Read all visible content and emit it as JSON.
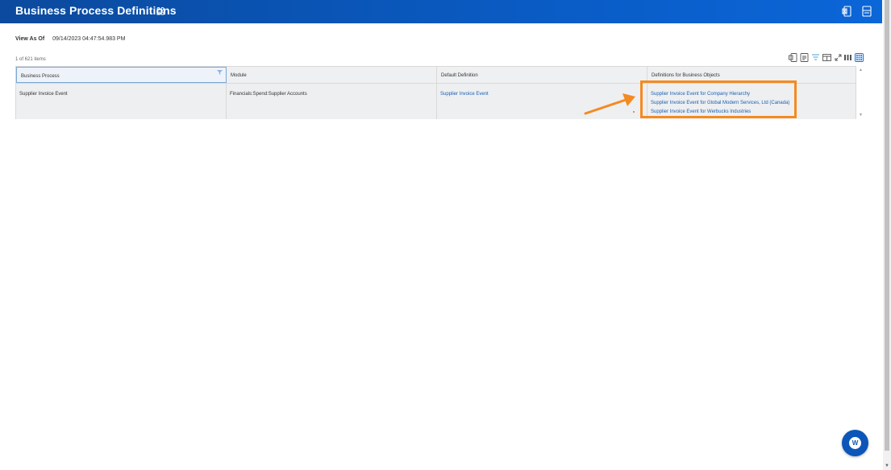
{
  "header": {
    "title": "Business Process Definitions",
    "related_icon": "related-actions-icon",
    "excel_icon": "export-excel-icon",
    "pdf_icon": "export-pdf-icon"
  },
  "view_as_of": {
    "label": "View As Of",
    "value": "09/14/2023 04:47:54.983 PM"
  },
  "items_count": "1 of 621 items",
  "toolbar_icons": [
    "export-excel-icon",
    "export-pdf-icon",
    "filter-icon",
    "view-column-icon",
    "fullscreen-icon",
    "list-view-icon",
    "grid-view-icon"
  ],
  "table": {
    "columns": [
      "Business Process",
      "Module",
      "Default Definition",
      "Definitions for Business Objects"
    ],
    "rows": [
      {
        "business_process": "Supplier Invoice Event",
        "module": "Financials:Spend:Supplier Accounts",
        "default_definition": "Supplier Invoice Event",
        "definitions": [
          "Supplier Invoice Event for Company Hierarchy",
          "Supplier Invoice Event for Global Modern Services, Ltd (Canada)",
          "Supplier Invoice Event for Werbucks Industries"
        ]
      }
    ]
  },
  "annotation_color": "#f58a20",
  "accent_color": "#0b56b8",
  "link_color": "#1a5fb4",
  "help_button": {
    "icon": "workday-assistant-icon",
    "glyph": "W"
  }
}
